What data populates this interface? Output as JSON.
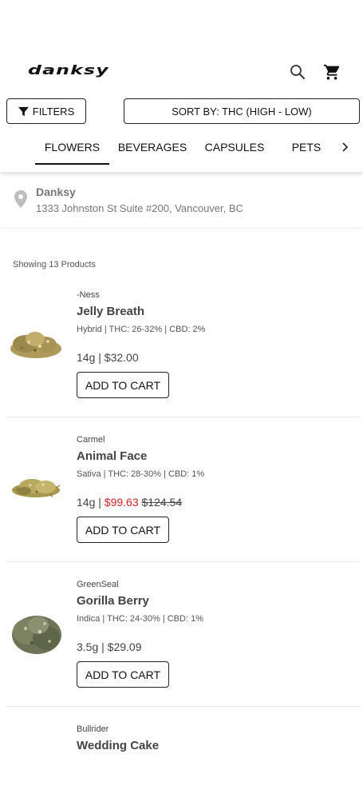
{
  "header": {
    "logo_text": "danksy",
    "search_icon": "search-icon",
    "cart_icon": "cart-icon",
    "filters_label": "FILTERS",
    "sort_label": "SORT BY: THC (HIGH - LOW)"
  },
  "tabs": [
    {
      "label": "FLOWERS",
      "active": true
    },
    {
      "label": "BEVERAGES",
      "active": false
    },
    {
      "label": "CAPSULES",
      "active": false
    },
    {
      "label": "PETS",
      "active": false
    }
  ],
  "store": {
    "name": "Danksy",
    "address": "1333 Johnston St Suite #200, Vancouver, BC"
  },
  "product_count_text": "Showing 13 Products",
  "products": [
    {
      "brand": "-Ness",
      "name": "Jelly Breath",
      "specs": "Hybrid | THC: 26-32% | CBD: 2%",
      "size": "14g |",
      "price": "$32.00",
      "sale_price": "",
      "original_price": "",
      "cta": "ADD TO CART"
    },
    {
      "brand": "Carmel",
      "name": "Animal Face",
      "specs": "Sativa | THC: 28-30% | CBD: 1%",
      "size": "14g |",
      "price": "",
      "sale_price": "$99.63",
      "original_price": "$124.54",
      "cta": "ADD TO CART"
    },
    {
      "brand": "GreenSeal",
      "name": "Gorilla Berry",
      "specs": "Indica | THC: 24-30% | CBD: 1%",
      "size": "3.5g |",
      "price": "$29.09",
      "sale_price": "",
      "original_price": "",
      "cta": "ADD TO CART"
    },
    {
      "brand": "Bullrider",
      "name": "Wedding Cake"
    }
  ],
  "colors": {
    "sale": "#d0202a",
    "text": "#444444",
    "border": "#222222"
  }
}
